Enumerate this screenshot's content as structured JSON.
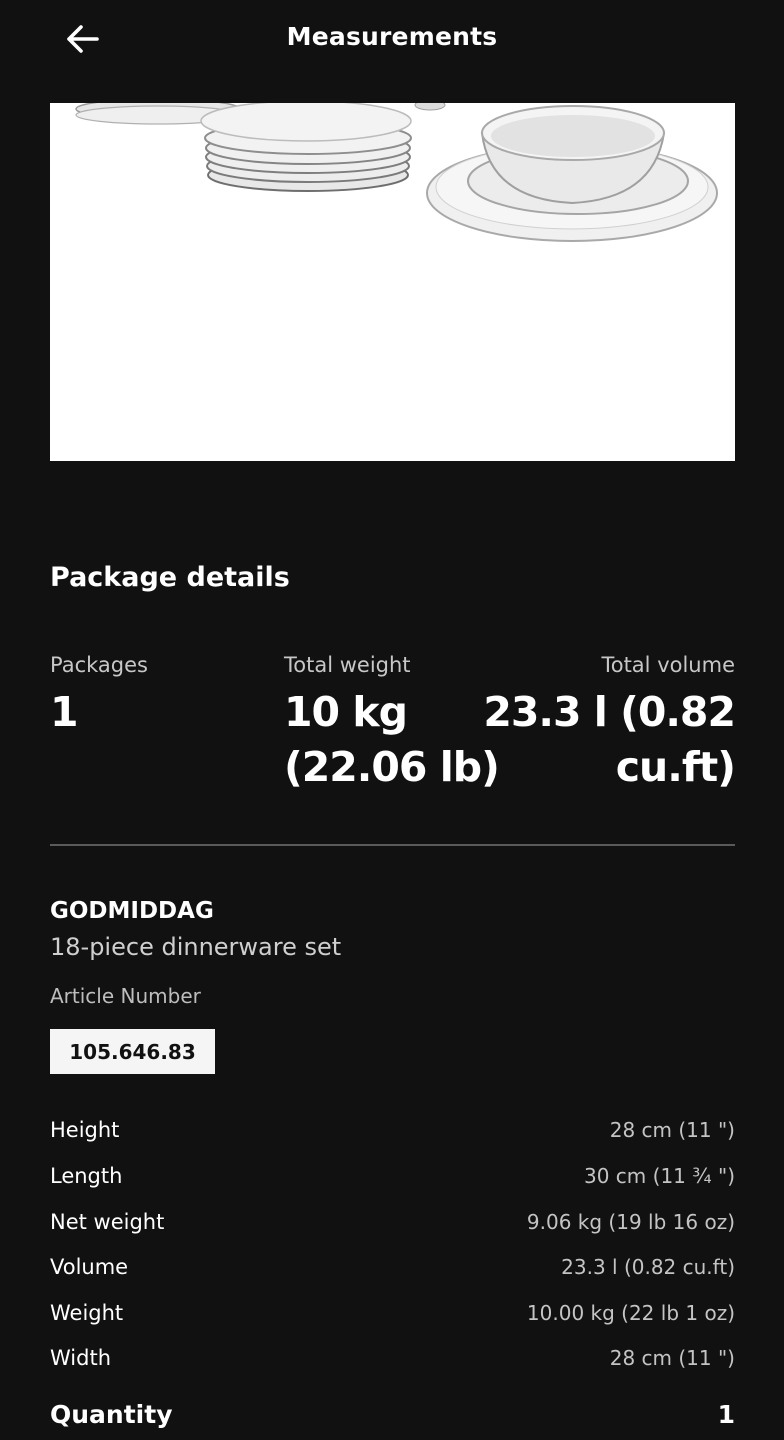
{
  "header": {
    "title": "Measurements",
    "back_icon": "arrow-left-icon"
  },
  "product_image": {
    "description_icon": "dinnerware-image"
  },
  "package_details": {
    "title": "Package details",
    "packages_label": "Packages",
    "packages_value": "1",
    "total_weight_label": "Total weight",
    "total_weight_line1": "10 kg",
    "total_weight_line2": "(22.06 lb)",
    "total_volume_label": "Total volume",
    "total_volume_line1": "23.3 l (0.82",
    "total_volume_line2": "cu.ft)"
  },
  "product": {
    "name": "GODMIDDAG",
    "description": "18-piece dinnerware set",
    "article_label": "Article Number",
    "article_number": "105.646.83"
  },
  "measurements": [
    {
      "label": "Height",
      "value": "28 cm (11 \")"
    },
    {
      "label": "Length",
      "value": "30 cm (11 ¾ \")"
    },
    {
      "label": "Net weight",
      "value": "9.06 kg (19 lb 16 oz)"
    },
    {
      "label": "Volume",
      "value": "23.3 l (0.82 cu.ft)"
    },
    {
      "label": "Weight",
      "value": "10.00 kg (22 lb 1 oz)"
    },
    {
      "label": "Width",
      "value": "28 cm (11 \")"
    }
  ],
  "quantity": {
    "label": "Quantity",
    "value": "1"
  },
  "colors": {
    "background": "#111111",
    "text": "#ffffff",
    "muted_text": "#c4c4c4",
    "badge_bg": "#f5f5f5"
  }
}
